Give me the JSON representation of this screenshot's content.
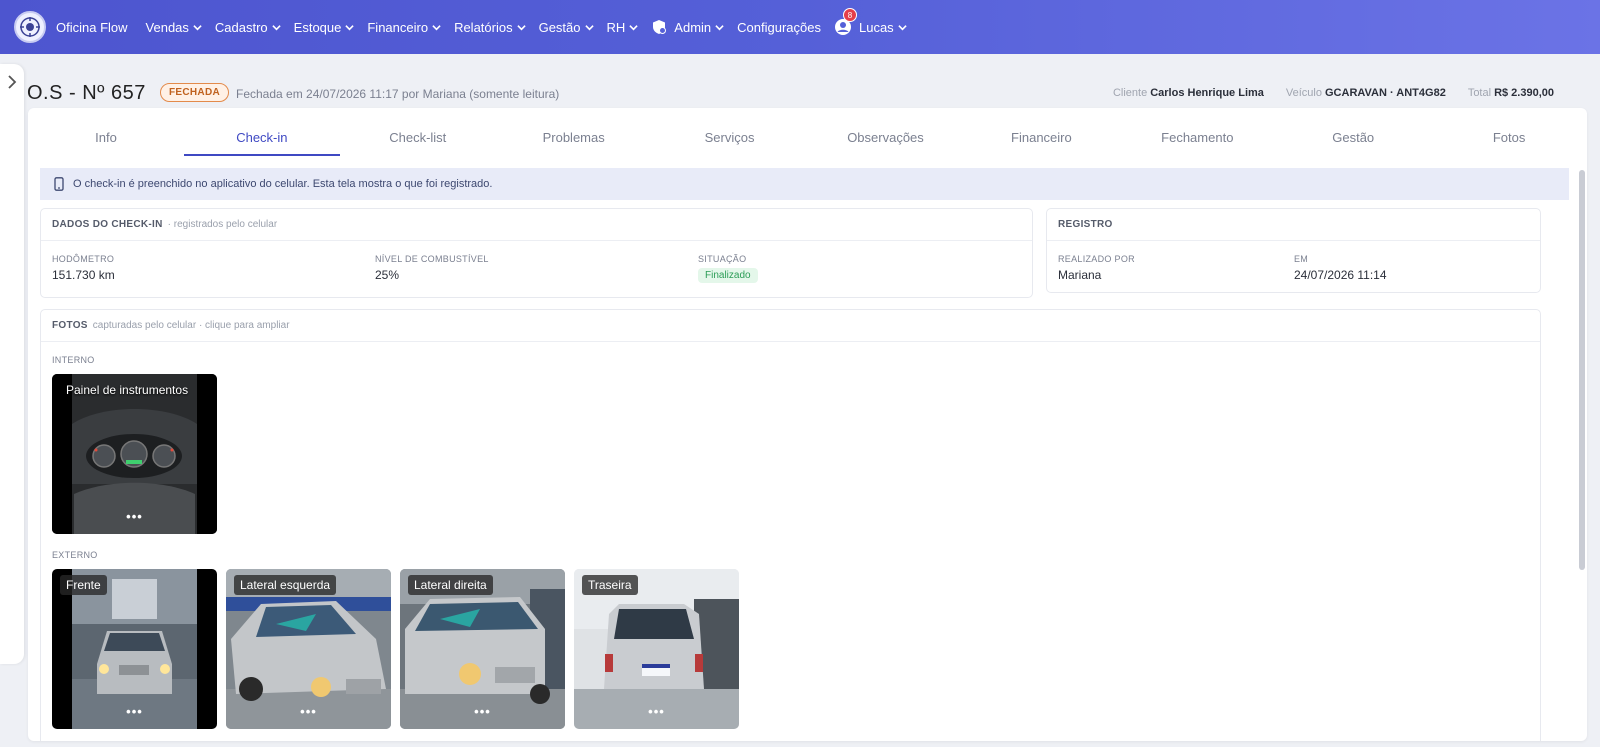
{
  "nav": {
    "brand": "Oficina Flow",
    "items": [
      {
        "label": "Vendas"
      },
      {
        "label": "Cadastro"
      },
      {
        "label": "Estoque"
      },
      {
        "label": "Financeiro"
      },
      {
        "label": "Relatórios"
      },
      {
        "label": "Gestão"
      },
      {
        "label": "RH"
      },
      {
        "label": "Admin"
      },
      {
        "label": "Configurações"
      }
    ],
    "user": {
      "name": "Lucas",
      "badge": "8"
    }
  },
  "header": {
    "title": "O.S - Nº 657",
    "status": "FECHADA",
    "closed_info": "Fechada em 24/07/2026 11:17 por Mariana (somente leitura)",
    "client_label": "Cliente",
    "client_value": "Carlos Henrique Lima",
    "vehicle_label": "Veículo",
    "vehicle_value": "GCARAVAN · ANT4G82",
    "total_label": "Total",
    "total_value": "R$ 2.390,00"
  },
  "tabs": [
    "Info",
    "Check-in",
    "Check-list",
    "Problemas",
    "Serviços",
    "Observações",
    "Financeiro",
    "Fechamento",
    "Gestão",
    "Fotos"
  ],
  "active_tab": "Check-in",
  "info_bar": "O check-in é preenchido no aplicativo do celular. Esta tela mostra o que foi registrado.",
  "checkin": {
    "title": "DADOS DO CHECK-IN",
    "subtitle": "· registrados pelo celular",
    "odometer_label": "HODÔMETRO",
    "odometer_value": "151.730 km",
    "fuel_label": "NÍVEL DE COMBUSTÍVEL",
    "fuel_value": "25%",
    "status_label": "SITUAÇÃO",
    "status_value": "Finalizado"
  },
  "registro": {
    "title": "REGISTRO",
    "by_label": "REALIZADO POR",
    "by_value": "Mariana",
    "at_label": "EM",
    "at_value": "24/07/2026 11:14"
  },
  "photos": {
    "title": "FOTOS",
    "subtitle": "capturadas pelo celular · clique para ampliar",
    "internal_label": "INTERNO",
    "external_label": "EXTERNO",
    "internal": [
      {
        "label": "Painel de instrumentos"
      }
    ],
    "external": [
      {
        "label": "Frente"
      },
      {
        "label": "Lateral esquerda"
      },
      {
        "label": "Lateral direita"
      },
      {
        "label": "Traseira"
      }
    ],
    "dots": "•••"
  },
  "colors": {
    "nav_start": "#4d55cf",
    "nav_end": "#6b73e6",
    "accent": "#3f49c3",
    "status_closed": "#e38a4a",
    "status_ok": "#2c9d57"
  }
}
